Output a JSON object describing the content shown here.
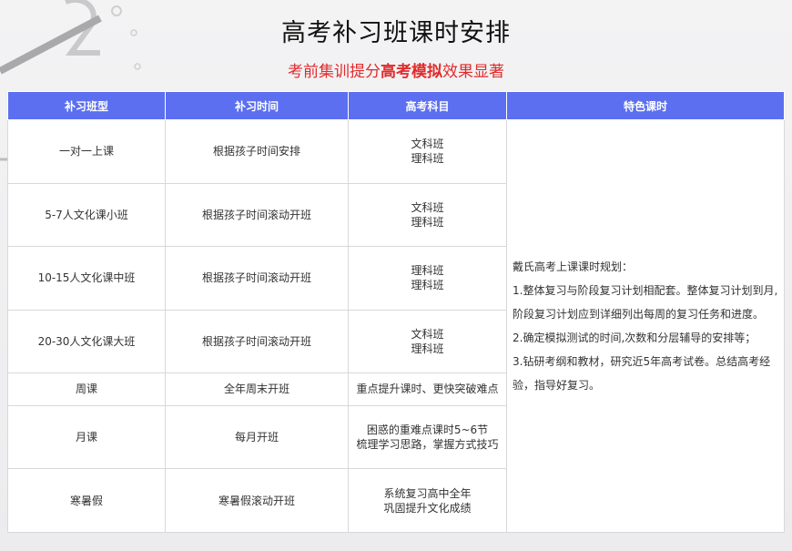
{
  "page": {
    "title": "高考补习班课时安排",
    "subtitle_prefix": "考前集训提分",
    "subtitle_highlight": "高考模拟",
    "subtitle_suffix": "效果显著",
    "colors": {
      "header_bg": "#5b6ff0",
      "accent_red": "#e12b2b"
    }
  },
  "table": {
    "headers": [
      "补习班型",
      "补习时间",
      "高考科目",
      "特色课时"
    ],
    "rows": [
      {
        "type": "一对一上课",
        "time": "根据孩子时间安排",
        "subject": [
          "文科班",
          "理科班"
        ]
      },
      {
        "type": "5-7人文化课小班",
        "time": "根据孩子时间滚动开班",
        "subject": [
          "文科班",
          "理科班"
        ]
      },
      {
        "type": "10-15人文化课中班",
        "time": "根据孩子时间滚动开班",
        "subject": [
          "理科班",
          "理科班"
        ]
      },
      {
        "type": "20-30人文化课大班",
        "time": "根据孩子时间滚动开班",
        "subject": [
          "文科班",
          "理科班"
        ]
      },
      {
        "type": "周课",
        "time": "全年周末开班",
        "subject": [
          "重点提升课时、更快突破难点"
        ]
      },
      {
        "type": "月课",
        "time": "每月开班",
        "subject": [
          "困惑的重难点课时5~6节",
          "梳理学习思路，掌握方式技巧"
        ]
      },
      {
        "type": "寒暑假",
        "time": "寒暑假滚动开班",
        "subject": [
          "系统复习高中全年",
          "巩固提升文化成绩"
        ]
      }
    ],
    "feature": {
      "intro": "戴氏高考上课课时规划：",
      "points": [
        "1.整体复习与阶段复习计划相配套。整体复习计划到月,阶段复习计划应到详细列出每周的复习任务和进度。",
        "2.确定模拟测试的时间,次数和分层辅导的安排等；",
        "3.钻研考纲和教材，研究近5年高考试卷。总结高考经验，指导好复习。"
      ]
    }
  }
}
